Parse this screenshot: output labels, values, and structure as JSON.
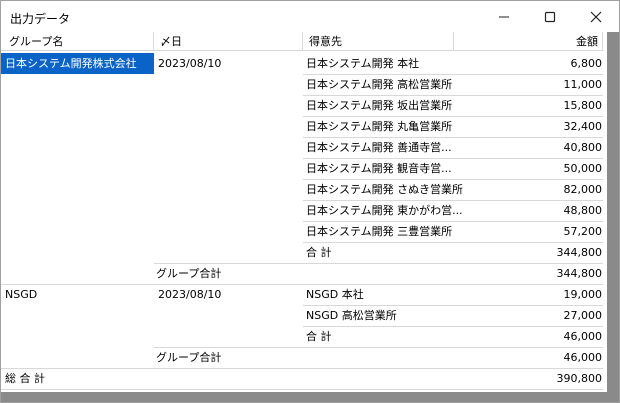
{
  "window": {
    "title": "出力データ"
  },
  "table": {
    "columns": [
      "グループ名",
      "〆日",
      "得意先",
      "金額"
    ],
    "group1": {
      "name": "日本システム開発株式会社",
      "date": "2023/08/10",
      "rows": [
        {
          "customer": "日本システム開発 本社",
          "amount": "6,800"
        },
        {
          "customer": "日本システム開発 高松営業所",
          "amount": "11,000"
        },
        {
          "customer": "日本システム開発 坂出営業所",
          "amount": "15,800"
        },
        {
          "customer": "日本システム開発 丸亀営業所",
          "amount": "32,400"
        },
        {
          "customer": "日本システム開発 善通寺営...",
          "amount": "40,800"
        },
        {
          "customer": "日本システム開発 観音寺営...",
          "amount": "50,000"
        },
        {
          "customer": "日本システム開発 さぬき営業所",
          "amount": "82,000"
        },
        {
          "customer": "日本システム開発 東かがわ営...",
          "amount": "48,800"
        },
        {
          "customer": "日本システム開発 三豊営業所",
          "amount": "57,200"
        }
      ],
      "subtotal_label": "合 計",
      "subtotal": "344,800",
      "group_total_label": "グループ合計",
      "group_total": "344,800"
    },
    "group2": {
      "name": "NSGD",
      "date": "2023/08/10",
      "rows": [
        {
          "customer": "NSGD 本社",
          "amount": "19,000"
        },
        {
          "customer": "NSGD 高松営業所",
          "amount": "27,000"
        }
      ],
      "subtotal_label": "合 計",
      "subtotal": "46,000",
      "group_total_label": "グループ合計",
      "group_total": "46,000"
    },
    "grand_total_label": "総 合 計",
    "grand_total": "390,800"
  }
}
